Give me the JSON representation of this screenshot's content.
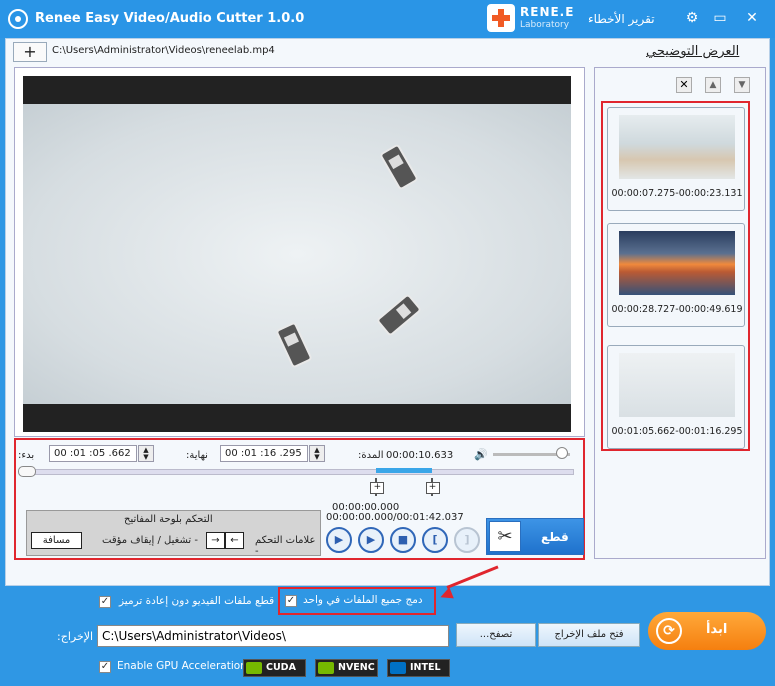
{
  "window": {
    "title": "Renee Easy Video/Audio Cutter 1.0.0",
    "brand_name": "RENE.E",
    "brand_sub": "Laboratory",
    "report_link": "تقرير الأخطاء",
    "settings_glyph": "⚙",
    "minimize_glyph": "▭",
    "close_glyph": "✕"
  },
  "file": {
    "add_glyph": "+",
    "path": "C:\\Users\\Administrator\\Videos\\reneelab.mp4"
  },
  "preview": {
    "title": "العرض التوضيحي",
    "delete_glyph": "✕",
    "up_glyph": "▲",
    "down_glyph": "▼",
    "clips": [
      {
        "time": "00:00:07.275-00:00:23.131"
      },
      {
        "time": "00:00:28.727-00:00:49.619"
      },
      {
        "time": "00:01:05.662-00:01:16.295"
      }
    ]
  },
  "controls": {
    "start_label": ":بدء",
    "start_value": "00 :01 :05 .662",
    "end_label": ":نهاية",
    "end_value": "00 :01 :16 .295",
    "duration_label": ":المدة",
    "duration_value": "00:00:10.633",
    "volume_glyph": "🔊",
    "volume_level": 0.9,
    "timeline_position": "00:00:00.000",
    "total_time": "00:00:00.000/00:01:42.037",
    "selection_start_fraction": 0.642,
    "selection_end_fraction": 0.742,
    "keyboard_title": "التحكم بلوحة المفاتيح",
    "marks_label": "علامات التحكم -",
    "play_pause_label": "تشغيل / إيقاف مؤقت -",
    "space_key": "مسافة",
    "left_key": "←",
    "right_key": "→",
    "buttons": {
      "play_glyph": "▶",
      "step_glyph": "▶",
      "stop_glyph": "■",
      "mark_start_glyph": "[",
      "mark_end_glyph": "]"
    },
    "cut_label": "قطع",
    "cut_glyph": "✂"
  },
  "options": {
    "no_reencode": {
      "label": "قطع ملفات الفيديو دون إعادة ترميز",
      "checked": true
    },
    "merge": {
      "label": "دمج جميع الملفات في واحد",
      "checked": true
    },
    "gpu": {
      "label": "Enable GPU Acceleration",
      "checked": true
    },
    "check_glyph": "✓"
  },
  "output": {
    "label": ":الإخراج",
    "path": "C:\\Users\\Administrator\\Videos\\",
    "browse_label": "...تصفح",
    "open_folder_label": "فتح ملف الإخراج"
  },
  "start_button": {
    "label": "ابدأ",
    "glyph": "⟳"
  },
  "gpu_badges": [
    {
      "name": "CUDA",
      "color": "#76b900"
    },
    {
      "name": "NVENC",
      "color": "#76b900"
    },
    {
      "name": "INTEL",
      "color": "#0071c5"
    }
  ]
}
